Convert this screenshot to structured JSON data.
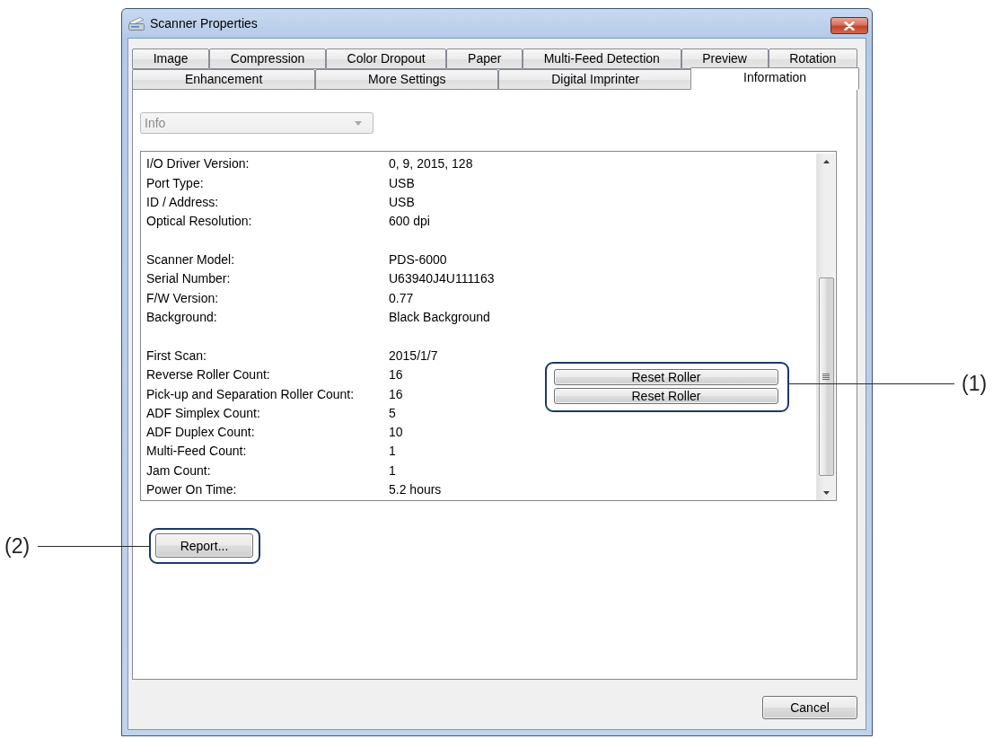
{
  "window": {
    "title": "Scanner Properties"
  },
  "tab_rows": [
    [
      {
        "label": "Image",
        "selected": false
      },
      {
        "label": "Compression",
        "selected": false
      },
      {
        "label": "Color Dropout",
        "selected": false
      },
      {
        "label": "Paper",
        "selected": false
      },
      {
        "label": "Multi-Feed Detection",
        "selected": false
      },
      {
        "label": "Preview",
        "selected": false
      },
      {
        "label": "Rotation",
        "selected": false
      }
    ],
    [
      {
        "label": "Enhancement",
        "selected": false
      },
      {
        "label": "More Settings",
        "selected": false
      },
      {
        "label": "Digital Imprinter",
        "selected": false
      },
      {
        "label": "Information",
        "selected": true
      }
    ]
  ],
  "dropdown": {
    "value": "Info",
    "disabled": true
  },
  "info_list": {
    "groups": [
      [
        {
          "label": "I/O Driver Version:",
          "value": "0, 9, 2015, 128"
        },
        {
          "label": "Port Type:",
          "value": "USB"
        },
        {
          "label": "ID / Address:",
          "value": "USB"
        },
        {
          "label": "Optical Resolution:",
          "value": "600 dpi"
        }
      ],
      [
        {
          "label": "Scanner Model:",
          "value": "PDS-6000"
        },
        {
          "label": "Serial Number:",
          "value": "U63940J4U111163"
        },
        {
          "label": "F/W Version:",
          "value": "0.77"
        },
        {
          "label": "Background:",
          "value": "Black Background"
        }
      ],
      [
        {
          "label": "First Scan:",
          "value": "2015/1/7"
        },
        {
          "label": "Reverse Roller Count:",
          "value": "16",
          "action": "Reset Roller"
        },
        {
          "label": "Pick-up and Separation Roller Count:",
          "value": "16",
          "action": "Reset Roller"
        },
        {
          "label": "ADF Simplex Count:",
          "value": "5"
        },
        {
          "label": "ADF Duplex Count:",
          "value": "10"
        },
        {
          "label": "Multi-Feed Count:",
          "value": "1"
        },
        {
          "label": "Jam Count:",
          "value": "1"
        },
        {
          "label": "Power On Time:",
          "value": "5.2 hours"
        }
      ]
    ]
  },
  "panel_buttons": [
    "Report..."
  ],
  "dialog_buttons": [
    "Cancel"
  ],
  "callouts": [
    {
      "label": "(1)"
    },
    {
      "label": "(2)"
    }
  ]
}
